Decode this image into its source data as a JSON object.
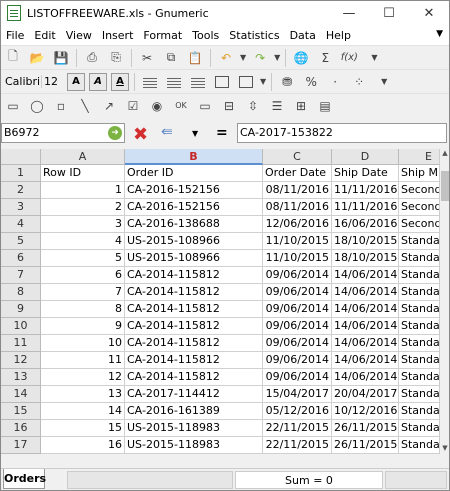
{
  "window": {
    "title": "LISTOFFREEWARE.xls - Gnumeric",
    "minimize": "—",
    "maximize": "☐",
    "close": "✕"
  },
  "menu": [
    "File",
    "Edit",
    "View",
    "Insert",
    "Format",
    "Tools",
    "Statistics",
    "Data",
    "Help"
  ],
  "format_toolbar": {
    "font_name": "Calibri",
    "font_size": "12",
    "bold": "A",
    "italic": "A",
    "underline": "A"
  },
  "entry": {
    "cell_ref": "B6972",
    "content": "CA-2017-153822",
    "equals": "="
  },
  "grid": {
    "columns": [
      "A",
      "B",
      "C",
      "D",
      "E"
    ],
    "selected_column": "B",
    "rows": [
      {
        "n": "1",
        "a": "Row ID",
        "b": "Order ID",
        "c": "Order Date",
        "d": "Ship Date",
        "e": "Ship M"
      },
      {
        "n": "2",
        "a": "1",
        "b": "CA-2016-152156",
        "c": "08/11/2016",
        "d": "11/11/2016",
        "e": "Second"
      },
      {
        "n": "3",
        "a": "2",
        "b": "CA-2016-152156",
        "c": "08/11/2016",
        "d": "11/11/2016",
        "e": "Second"
      },
      {
        "n": "4",
        "a": "3",
        "b": "CA-2016-138688",
        "c": "12/06/2016",
        "d": "16/06/2016",
        "e": "Second"
      },
      {
        "n": "5",
        "a": "4",
        "b": "US-2015-108966",
        "c": "11/10/2015",
        "d": "18/10/2015",
        "e": "Standa"
      },
      {
        "n": "6",
        "a": "5",
        "b": "US-2015-108966",
        "c": "11/10/2015",
        "d": "18/10/2015",
        "e": "Standa"
      },
      {
        "n": "7",
        "a": "6",
        "b": "CA-2014-115812",
        "c": "09/06/2014",
        "d": "14/06/2014",
        "e": "Standa"
      },
      {
        "n": "8",
        "a": "7",
        "b": "CA-2014-115812",
        "c": "09/06/2014",
        "d": "14/06/2014",
        "e": "Standa"
      },
      {
        "n": "9",
        "a": "8",
        "b": "CA-2014-115812",
        "c": "09/06/2014",
        "d": "14/06/2014",
        "e": "Standa"
      },
      {
        "n": "10",
        "a": "9",
        "b": "CA-2014-115812",
        "c": "09/06/2014",
        "d": "14/06/2014",
        "e": "Standa"
      },
      {
        "n": "11",
        "a": "10",
        "b": "CA-2014-115812",
        "c": "09/06/2014",
        "d": "14/06/2014",
        "e": "Standa"
      },
      {
        "n": "12",
        "a": "11",
        "b": "CA-2014-115812",
        "c": "09/06/2014",
        "d": "14/06/2014",
        "e": "Standa"
      },
      {
        "n": "13",
        "a": "12",
        "b": "CA-2014-115812",
        "c": "09/06/2014",
        "d": "14/06/2014",
        "e": "Standa"
      },
      {
        "n": "14",
        "a": "13",
        "b": "CA-2017-114412",
        "c": "15/04/2017",
        "d": "20/04/2017",
        "e": "Standa"
      },
      {
        "n": "15",
        "a": "14",
        "b": "CA-2016-161389",
        "c": "05/12/2016",
        "d": "10/12/2016",
        "e": "Standa"
      },
      {
        "n": "16",
        "a": "15",
        "b": "US-2015-118983",
        "c": "22/11/2015",
        "d": "26/11/2015",
        "e": "Standa"
      },
      {
        "n": "17",
        "a": "16",
        "b": "US-2015-118983",
        "c": "22/11/2015",
        "d": "26/11/2015",
        "e": "Standa"
      }
    ]
  },
  "status": {
    "sheet_tab": "Orders",
    "sum": "Sum = 0"
  },
  "colors": {
    "selected_column_header": "#cfe0f5",
    "selected_column_text": "#c62828",
    "cancel": "#d32f2f"
  }
}
